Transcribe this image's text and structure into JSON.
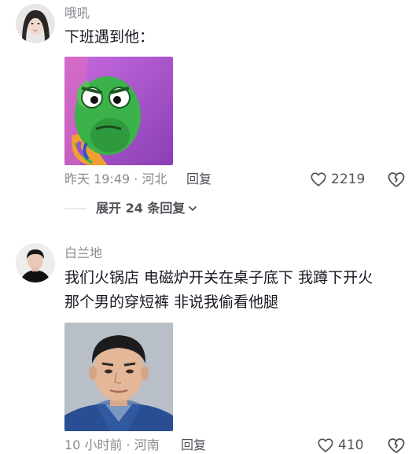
{
  "comments": [
    {
      "username": "哦吼",
      "text": "下班遇到他：",
      "image_desc": "green-lizard-meme",
      "time": "昨天 19:49",
      "location": "河北",
      "reply_label": "回复",
      "likes": "2219",
      "expand_label": "展开 24 条回复",
      "icons": {
        "like": "heart-icon",
        "dislike": "broken-heart-icon",
        "expand": "chevron-down-icon"
      },
      "colors": {
        "meta": "#8a8b91",
        "text": "#161823"
      }
    },
    {
      "username": "白兰地",
      "text_line1": "我们火锅店 电磁炉开关在桌子底下 我蹲下开火",
      "text_line2": "那个男的穿短裤 非说我偷看他腿",
      "image_desc": "young-man-portrait",
      "time": "10 小时前",
      "location": "河南",
      "reply_label": "回复",
      "likes": "410",
      "icons": {
        "like": "heart-icon",
        "dislike": "broken-heart-icon"
      }
    }
  ],
  "separator": " · "
}
